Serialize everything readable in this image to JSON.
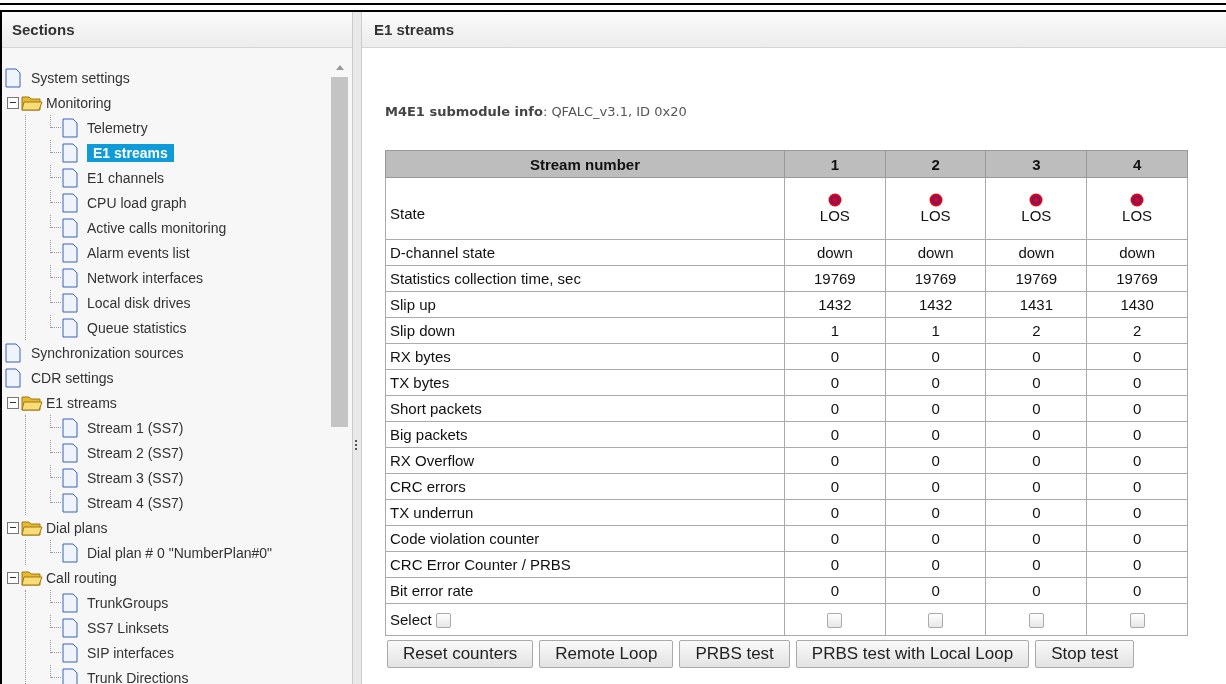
{
  "sidebar": {
    "title": "Sections",
    "tree": [
      {
        "label": "System settings",
        "kind": "page",
        "selected": false
      },
      {
        "label": "Monitoring",
        "kind": "folder",
        "selected": false,
        "expanded": true,
        "children": [
          {
            "label": "Telemetry",
            "kind": "page",
            "selected": false
          },
          {
            "label": "E1 streams",
            "kind": "page",
            "selected": true
          },
          {
            "label": "E1 channels",
            "kind": "page",
            "selected": false
          },
          {
            "label": "CPU load graph",
            "kind": "page",
            "selected": false
          },
          {
            "label": "Active calls monitoring",
            "kind": "page",
            "selected": false
          },
          {
            "label": "Alarm events list",
            "kind": "page",
            "selected": false
          },
          {
            "label": "Network interfaces",
            "kind": "page",
            "selected": false
          },
          {
            "label": "Local disk drives",
            "kind": "page",
            "selected": false
          },
          {
            "label": "Queue statistics",
            "kind": "page",
            "selected": false
          }
        ]
      },
      {
        "label": "Synchronization sources",
        "kind": "page",
        "selected": false
      },
      {
        "label": "CDR settings",
        "kind": "page",
        "selected": false
      },
      {
        "label": "E1 streams",
        "kind": "folder",
        "selected": false,
        "expanded": true,
        "children": [
          {
            "label": "Stream 1 (SS7)",
            "kind": "page",
            "selected": false
          },
          {
            "label": "Stream 2 (SS7)",
            "kind": "page",
            "selected": false
          },
          {
            "label": "Stream 3 (SS7)",
            "kind": "page",
            "selected": false
          },
          {
            "label": "Stream 4 (SS7)",
            "kind": "page",
            "selected": false
          }
        ]
      },
      {
        "label": "Dial plans",
        "kind": "folder",
        "selected": false,
        "expanded": true,
        "children": [
          {
            "label": "Dial plan # 0 \"NumberPlan#0\"",
            "kind": "page",
            "selected": false
          }
        ]
      },
      {
        "label": "Call routing",
        "kind": "folder",
        "selected": false,
        "expanded": true,
        "children": [
          {
            "label": "TrunkGroups",
            "kind": "page",
            "selected": false
          },
          {
            "label": "SS7 Linksets",
            "kind": "page",
            "selected": false
          },
          {
            "label": "SIP interfaces",
            "kind": "page",
            "selected": false
          },
          {
            "label": "Trunk Directions",
            "kind": "page",
            "selected": false
          }
        ]
      }
    ]
  },
  "main": {
    "title": "E1 streams",
    "info_label": "M4E1 submodule info",
    "info_value": ": QFALC_v3.1, ID 0x20",
    "table": {
      "columns": [
        "Stream number",
        "1",
        "2",
        "3",
        "4"
      ],
      "state_row": {
        "label": "State",
        "values": [
          "LOS",
          "LOS",
          "LOS",
          "LOS"
        ]
      },
      "rows": [
        {
          "label": "D-channel state",
          "values": [
            "down",
            "down",
            "down",
            "down"
          ]
        },
        {
          "label": "Statistics collection time, sec",
          "values": [
            "19769",
            "19769",
            "19769",
            "19769"
          ]
        },
        {
          "label": "Slip up",
          "values": [
            "1432",
            "1432",
            "1431",
            "1430"
          ]
        },
        {
          "label": "Slip down",
          "values": [
            "1",
            "1",
            "2",
            "2"
          ]
        },
        {
          "label": "RX bytes",
          "values": [
            "0",
            "0",
            "0",
            "0"
          ]
        },
        {
          "label": "TX bytes",
          "values": [
            "0",
            "0",
            "0",
            "0"
          ]
        },
        {
          "label": "Short packets",
          "values": [
            "0",
            "0",
            "0",
            "0"
          ]
        },
        {
          "label": "Big packets",
          "values": [
            "0",
            "0",
            "0",
            "0"
          ]
        },
        {
          "label": "RX Overflow",
          "values": [
            "0",
            "0",
            "0",
            "0"
          ]
        },
        {
          "label": "CRC errors",
          "values": [
            "0",
            "0",
            "0",
            "0"
          ]
        },
        {
          "label": "TX underrun",
          "values": [
            "0",
            "0",
            "0",
            "0"
          ]
        },
        {
          "label": "Code violation counter",
          "values": [
            "0",
            "0",
            "0",
            "0"
          ]
        },
        {
          "label": "CRC Error Counter / PRBS",
          "values": [
            "0",
            "0",
            "0",
            "0"
          ]
        },
        {
          "label": "Bit error rate",
          "values": [
            "0",
            "0",
            "0",
            "0"
          ]
        }
      ],
      "select_row": {
        "label": "Select",
        "checked": false,
        "streams": [
          {
            "checked": false
          },
          {
            "checked": false
          },
          {
            "checked": false
          },
          {
            "checked": false
          }
        ]
      }
    },
    "buttons": [
      "Reset counters",
      "Remote Loop",
      "PRBS test",
      "PRBS test with Local Loop",
      "Stop test"
    ]
  }
}
